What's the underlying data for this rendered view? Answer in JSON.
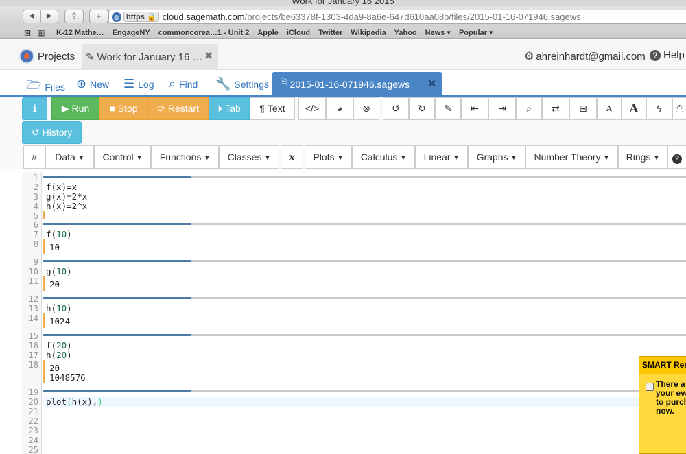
{
  "window": {
    "title": "Work for January 16 2015"
  },
  "browser": {
    "address_scheme": "https",
    "address_host": "cloud.sagemath.com",
    "address_path": "/projects/be63378f-1303-4da9-8a6e-647d610aa08b/files/2015-01-16-071946.sagews",
    "bookmarks": [
      "K-12 Mathe…",
      "EngageNY",
      "commoncorea…1 - Unit 2",
      "Apple",
      "iCloud",
      "Twitter",
      "Wikipedia",
      "Yahoo",
      "News ▾",
      "Popular ▾"
    ]
  },
  "header": {
    "projects_label": "Projects",
    "work_tab_label": "Work for January 16 …",
    "account_email": "ahreinhardt@gmail.com",
    "help_label": "Help"
  },
  "filebar": {
    "files": "Files",
    "new": "New",
    "log": "Log",
    "find": "Find",
    "settings": "Settings",
    "file_tab": "2015-01-16-071946.sagews"
  },
  "toolbar": {
    "run": "Run",
    "stop": "Stop",
    "restart": "Restart",
    "tab": "Tab",
    "text": "Text",
    "history": "History"
  },
  "menus": {
    "hash": "#",
    "data": "Data",
    "control": "Control",
    "functions": "Functions",
    "classes": "Classes",
    "x": "x",
    "plots": "Plots",
    "calculus": "Calculus",
    "linear": "Linear",
    "graphs": "Graphs",
    "number_theory": "Number Theory",
    "rings": "Rings"
  },
  "editor": {
    "line_numbers": [
      "1",
      "2",
      "3",
      "4",
      "5",
      "6",
      "7",
      "8",
      "9",
      "10",
      "11",
      "12",
      "13",
      "14",
      "15",
      "16",
      "17",
      "18",
      "19",
      "20",
      "21",
      "22",
      "23",
      "24",
      "25"
    ],
    "cells": {
      "c1_l1": "f(x)=x",
      "c1_l2": "g(x)=2*x",
      "c1_l3": "h(x)=2^x",
      "c2_code_a": "f(",
      "c2_code_n": "10",
      "c2_code_b": ")",
      "c2_out": "10",
      "c3_code_a": "g(",
      "c3_code_n": "10",
      "c3_code_b": ")",
      "c3_out": "20",
      "c4_code_a": "h(",
      "c4_code_n": "10",
      "c4_code_b": ")",
      "c4_out": "1024",
      "c5_l1_a": "f(",
      "c5_l1_n": "20",
      "c5_l1_b": ")",
      "c5_l2_a": "h(",
      "c5_l2_n": "20",
      "c5_l2_b": ")",
      "c5_out1": "20",
      "c5_out2": "1048576",
      "c6_code_a": "plot",
      "c6_code_p1": "(",
      "c6_code_mid": "h(x),",
      "c6_code_p2": ")"
    }
  },
  "smart_popup": {
    "title": "SMART Res",
    "body": "There a\nyour eva\nto purch\nnow."
  }
}
